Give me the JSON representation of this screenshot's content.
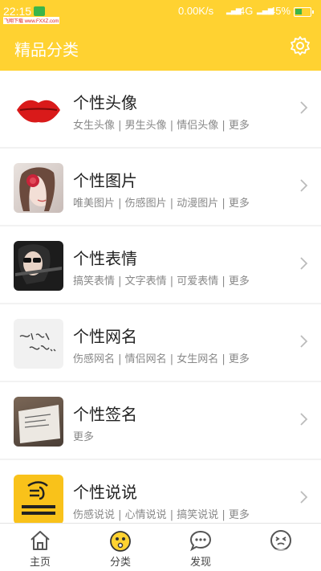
{
  "status_bar": {
    "time": "22:15",
    "watermark": "飞翔下载 www.FXXZ.com",
    "net_speed": "0.00K/s",
    "network_type": "4G",
    "battery": "45%",
    "battery_level": 0.45
  },
  "header": {
    "title": "精品分类",
    "settings_icon": "gear-icon"
  },
  "categories": [
    {
      "name": "个性头像",
      "sub": "女生头像 | 男生头像 | 情侣头像 | 更多",
      "thumb": "lips-image"
    },
    {
      "name": "个性图片",
      "sub": "唯美图片 | 伤感图片 | 动漫图片 | 更多",
      "thumb": "girl-rose-image"
    },
    {
      "name": "个性表情",
      "sub": "搞笑表情 | 文字表情 | 可爱表情 | 更多",
      "thumb": "sunglasses-girl-image"
    },
    {
      "name": "个性网名",
      "sub": "伤感网名 | 情侣网名 | 女生网名 | 更多",
      "thumb": "handwriting-image"
    },
    {
      "name": "个性签名",
      "sub": "更多",
      "thumb": "note-paper-image"
    },
    {
      "name": "个性说说",
      "sub": "伤感说说 | 心情说说 | 搞笑说说 | 更多",
      "thumb": "yellow-plug-image"
    }
  ],
  "bottom_nav": [
    {
      "label": "主页",
      "icon": "home-icon"
    },
    {
      "label": "分类",
      "icon": "category-face-icon",
      "active": true
    },
    {
      "label": "发现",
      "icon": "chat-bubble-icon"
    },
    {
      "label": "",
      "icon": "face-icon"
    }
  ],
  "colors": {
    "accent": "#ffd231",
    "text": "#222222",
    "subtext": "#888888"
  }
}
